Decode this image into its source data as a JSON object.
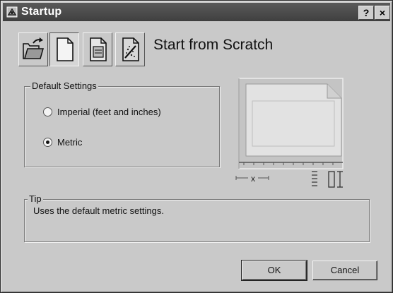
{
  "window": {
    "title": "Startup",
    "help_label": "?",
    "close_label": "×"
  },
  "tabs": [
    {
      "name": "open-drawing",
      "icon": "open-folder-icon"
    },
    {
      "name": "start-from-scratch",
      "icon": "blank-page-icon"
    },
    {
      "name": "use-template",
      "icon": "template-page-icon"
    },
    {
      "name": "use-wizard",
      "icon": "wizard-page-icon"
    }
  ],
  "heading": "Start from Scratch",
  "default_settings": {
    "legend": "Default Settings",
    "options": [
      {
        "label": "Imperial (feet and inches)",
        "checked": false
      },
      {
        "label": "Metric",
        "checked": true
      }
    ]
  },
  "preview": {
    "x_label": "x",
    "icon": "drawing-limits-preview-icon"
  },
  "tip": {
    "legend": "Tip",
    "text": "Uses the default metric settings."
  },
  "buttons": {
    "ok": "OK",
    "cancel": "Cancel"
  }
}
